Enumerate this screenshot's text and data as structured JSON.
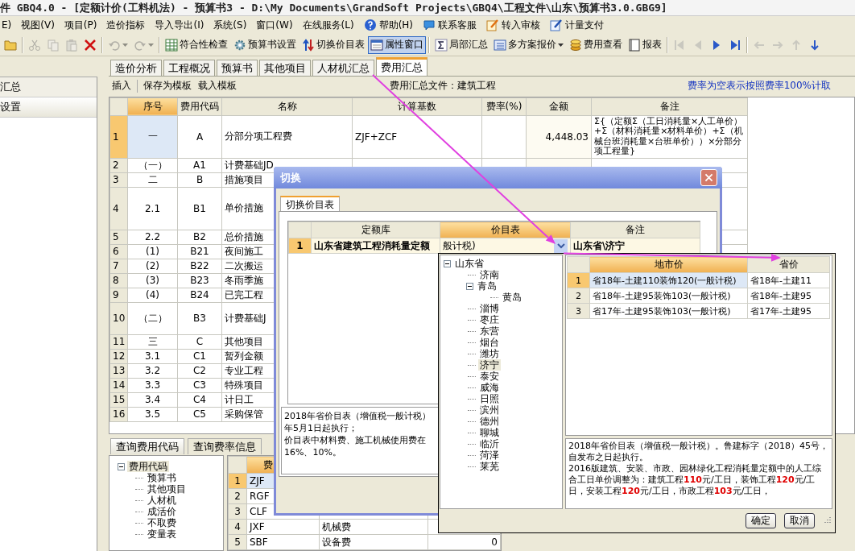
{
  "window": {
    "title": "件 GBQ4.0 - [定额计价(工料机法) - 预算书3 - D:\\My Documents\\GrandSoft Projects\\GBQ4\\工程文件\\山东\\预算书3.0.GBG9]"
  },
  "menu": [
    {
      "label": "E)",
      "kind": "text"
    },
    {
      "label": "视图(V)",
      "kind": "text"
    },
    {
      "label": "项目(P)",
      "kind": "text"
    },
    {
      "label": "造价指标",
      "kind": "text"
    },
    {
      "label": "导入导出(I)",
      "kind": "text"
    },
    {
      "label": "系统(S)",
      "kind": "text"
    },
    {
      "label": "窗口(W)",
      "kind": "text"
    },
    {
      "label": "在线服务(L)",
      "kind": "text"
    },
    {
      "label": "帮助(H)",
      "kind": "help"
    },
    {
      "label": "联系客服",
      "kind": "service"
    },
    {
      "label": "转入审核",
      "kind": "review"
    },
    {
      "label": "计量支付",
      "kind": "payment"
    }
  ],
  "toolbar": [
    [
      {
        "kind": "folder",
        "disabled": false,
        "selected": false,
        "dropdown": false
      }
    ],
    [
      {
        "kind": "cut",
        "disabled": true,
        "selected": false,
        "dropdown": false
      },
      {
        "kind": "copy",
        "disabled": true,
        "selected": false,
        "dropdown": false
      },
      {
        "kind": "paste",
        "disabled": true,
        "selected": false,
        "dropdown": false
      },
      {
        "kind": "delete",
        "disabled": false,
        "selected": false,
        "dropdown": false
      }
    ],
    [
      {
        "kind": "undo",
        "disabled": true,
        "selected": false,
        "dropdown": true
      },
      {
        "kind": "redo",
        "disabled": true,
        "selected": false,
        "dropdown": true
      }
    ],
    [
      {
        "kind": "check",
        "label": "符合性检查",
        "disabled": false,
        "selected": false,
        "dropdown": false
      },
      {
        "kind": "gear",
        "label": "预算书设置",
        "disabled": false,
        "selected": false,
        "dropdown": false
      },
      {
        "kind": "swap",
        "label": "切换价目表",
        "disabled": false,
        "selected": false,
        "dropdown": false
      },
      {
        "kind": "window",
        "label": "属性窗口",
        "disabled": false,
        "selected": true,
        "dropdown": false
      }
    ],
    [
      {
        "kind": "sigma",
        "label": "局部汇总",
        "disabled": false,
        "selected": false,
        "dropdown": false
      },
      {
        "kind": "list",
        "label": "多方案报价",
        "disabled": false,
        "selected": false,
        "dropdown": true
      },
      {
        "kind": "coins",
        "label": "费用查看",
        "disabled": false,
        "selected": false,
        "dropdown": false
      },
      {
        "kind": "report",
        "label": "报表",
        "disabled": false,
        "selected": false,
        "dropdown": false
      }
    ],
    [
      {
        "kind": "first",
        "disabled": true,
        "selected": false,
        "dropdown": false
      },
      {
        "kind": "prev",
        "disabled": true,
        "selected": false,
        "dropdown": false
      },
      {
        "kind": "next",
        "disabled": false,
        "selected": false,
        "dropdown": false
      },
      {
        "kind": "last",
        "disabled": false,
        "selected": false,
        "dropdown": false
      }
    ],
    [
      {
        "kind": "back",
        "disabled": true,
        "selected": false,
        "dropdown": false
      },
      {
        "kind": "forward",
        "disabled": true,
        "selected": false,
        "dropdown": false
      },
      {
        "kind": "up",
        "disabled": true,
        "selected": false,
        "dropdown": false
      },
      {
        "kind": "down",
        "disabled": false,
        "selected": false,
        "dropdown": false
      }
    ]
  ],
  "sidebar": {
    "items": [
      {
        "label": "汇总",
        "selected": false
      },
      {
        "label": "设置",
        "selected": true
      }
    ]
  },
  "tabs": [
    {
      "label": "造价分析",
      "selected": false
    },
    {
      "label": "工程概况",
      "selected": false
    },
    {
      "label": "预算书",
      "selected": false
    },
    {
      "label": "其他项目",
      "selected": false
    },
    {
      "label": "人材机汇总",
      "selected": false
    },
    {
      "label": "费用汇总",
      "selected": true
    }
  ],
  "fee_toolbar": {
    "groups": [
      [
        "插入"
      ],
      [
        "保存为模板",
        "载入模板"
      ]
    ],
    "file_label": "费用汇总文件：建筑工程",
    "note": "费率为空表示按照费率100%计取"
  },
  "fee_table": {
    "columns": [
      {
        "label": "序号",
        "selected": true
      },
      {
        "label": "费用代码",
        "selected": false
      },
      {
        "label": "名称",
        "selected": false
      },
      {
        "label": "计算基数",
        "selected": false
      },
      {
        "label": "费率(%)",
        "selected": false
      },
      {
        "label": "金额",
        "selected": false
      },
      {
        "label": "备注",
        "selected": false
      }
    ],
    "rows": [
      {
        "no": "1",
        "seq": "一",
        "code": "A",
        "name": "分部分项工程费",
        "basis": "ZJF+ZCF",
        "amount": "4,448.03",
        "remark": "Σ{（定额Σ（工日消耗量×人工单价）+Σ（材料消耗量×材料单价）+Σ（机械台班消耗量×台班单价））×分部分项工程量}",
        "kind": "quad",
        "selected": true
      },
      {
        "no": "2",
        "seq": "（一）",
        "code": "A1",
        "name": "计费基础JD",
        "kind": "line",
        "selected": false
      },
      {
        "no": "3",
        "seq": "二",
        "code": "B",
        "name": "措施项目",
        "kind": "line",
        "selected": false
      },
      {
        "no": "4",
        "seq": "2.1",
        "code": "B1",
        "name": "单价措施",
        "kind": "quad",
        "selected": false
      },
      {
        "no": "5",
        "seq": "2.2",
        "code": "B2",
        "name": "总价措施",
        "kind": "line",
        "selected": false
      },
      {
        "no": "6",
        "seq": "(1)",
        "code": "B21",
        "name": "夜间施工",
        "kind": "line",
        "selected": false
      },
      {
        "no": "7",
        "seq": "(2)",
        "code": "B22",
        "name": "二次搬运",
        "kind": "line",
        "selected": false
      },
      {
        "no": "8",
        "seq": "(3)",
        "code": "B23",
        "name": "冬雨季施",
        "kind": "line",
        "selected": false
      },
      {
        "no": "9",
        "seq": "(4)",
        "code": "B24",
        "name": "已完工程",
        "kind": "line",
        "selected": false
      },
      {
        "no": "10",
        "seq": "（二）",
        "code": "B3",
        "name": "计费基础J",
        "kind": "double",
        "selected": false
      },
      {
        "no": "11",
        "seq": "三",
        "code": "C",
        "name": "其他项目",
        "kind": "line",
        "selected": false
      },
      {
        "no": "12",
        "seq": "3.1",
        "code": "C1",
        "name": "暂列金额",
        "kind": "line",
        "selected": false
      },
      {
        "no": "13",
        "seq": "3.2",
        "code": "C2",
        "name": "专业工程",
        "kind": "line",
        "selected": false
      },
      {
        "no": "14",
        "seq": "3.3",
        "code": "C3",
        "name": "特殊项目",
        "kind": "line",
        "selected": false
      },
      {
        "no": "15",
        "seq": "3.4",
        "code": "C4",
        "name": "计日工",
        "kind": "line",
        "selected": false
      },
      {
        "no": "16",
        "seq": "3.5",
        "code": "C5",
        "name": "采购保管",
        "kind": "line",
        "selected": false
      }
    ]
  },
  "query_panel": {
    "tabs": [
      {
        "label": "查询费用代码",
        "selected": true
      },
      {
        "label": "查询费率信息",
        "selected": false
      }
    ],
    "tree": [
      {
        "label": "费用代码",
        "expanded": true,
        "selected": true,
        "children": [
          {
            "label": "预算书",
            "selected": false
          },
          {
            "label": "其他项目",
            "selected": false
          },
          {
            "label": "人材机",
            "selected": false
          },
          {
            "label": "成活价",
            "selected": false
          },
          {
            "label": "不取费",
            "selected": false
          },
          {
            "label": "变量表",
            "selected": false
          }
        ]
      }
    ],
    "grid": {
      "columns": [
        {
          "label": "费",
          "selected": true
        }
      ],
      "rows": [
        {
          "no": "1",
          "code": "ZJF",
          "selected": true
        },
        {
          "no": "2",
          "code": "RGF",
          "selected": false
        },
        {
          "no": "3",
          "code": "CLF",
          "selected": false
        },
        {
          "no": "4",
          "code": "JXF",
          "name": "机械费",
          "selected": false
        },
        {
          "no": "5",
          "code": "SBF",
          "name": "设备费",
          "value": "0",
          "selected": false
        }
      ]
    }
  },
  "dialog": {
    "title": "切换",
    "tabs": [
      {
        "label": "切换价目表",
        "selected": true
      }
    ],
    "grid": {
      "columns": [
        {
          "label": "定额库",
          "selected": false
        },
        {
          "label": "价目表",
          "selected": true
        },
        {
          "label": "备注",
          "selected": false
        }
      ],
      "rows": [
        {
          "no": "1",
          "library": "山东省建筑工程消耗量定额",
          "price_table": "般计税)",
          "remark": "山东省\\济宁",
          "selected": true
        }
      ]
    },
    "description_lines": [
      "2018年省价目表（增值税一般计税）",
      "年5月1日起执行；",
      "价目表中材料费、施工机械使用费在",
      "16%、10%。"
    ]
  },
  "price_dropdown": {
    "tree": [
      {
        "label": "山东省",
        "expanded": true,
        "selected": false,
        "children": [
          {
            "label": "济南",
            "selected": false
          },
          {
            "label": "青岛",
            "expanded": true,
            "selected": false,
            "children": [
              {
                "label": "黄岛",
                "selected": false
              }
            ]
          },
          {
            "label": "淄博",
            "selected": false
          },
          {
            "label": "枣庄",
            "selected": false
          },
          {
            "label": "东营",
            "selected": false
          },
          {
            "label": "烟台",
            "selected": false
          },
          {
            "label": "潍坊",
            "selected": false
          },
          {
            "label": "济宁",
            "selected": true
          },
          {
            "label": "泰安",
            "selected": false
          },
          {
            "label": "威海",
            "selected": false
          },
          {
            "label": "日照",
            "selected": false
          },
          {
            "label": "滨州",
            "selected": false
          },
          {
            "label": "德州",
            "selected": false
          },
          {
            "label": "聊城",
            "selected": false
          },
          {
            "label": "临沂",
            "selected": false
          },
          {
            "label": "菏泽",
            "selected": false
          },
          {
            "label": "莱芜",
            "selected": false
          }
        ]
      }
    ],
    "grid": {
      "columns": [
        {
          "label": "地市价",
          "selected": true
        },
        {
          "label": "省价",
          "selected": false
        }
      ],
      "rows": [
        {
          "no": "1",
          "city_price": "省18年-土建110装饰120(一般计税)",
          "province_price": "省18年-土建11",
          "selected": true
        },
        {
          "no": "2",
          "city_price": "省18年-土建95装饰103(一般计税)",
          "province_price": "省18年-土建95",
          "selected": false
        },
        {
          "no": "3",
          "city_price": "省17年-土建95装饰103(一般计税)",
          "province_price": "省17年-土建95",
          "selected": false
        }
      ]
    },
    "description": [
      "2018年省价目表（增值税一般计税）。鲁建标字（2018）45号，自发布之日起执行。",
      "2016版建筑、安装、市政、园林绿化工程消耗量定额中的人工综合工日单价调整为：建筑工程**110**元/工日，装饰工程**120**元/工日，安装工程**120**元/工日，市政工程**103**元/工日，"
    ],
    "buttons": [
      "确定",
      "取消"
    ]
  }
}
